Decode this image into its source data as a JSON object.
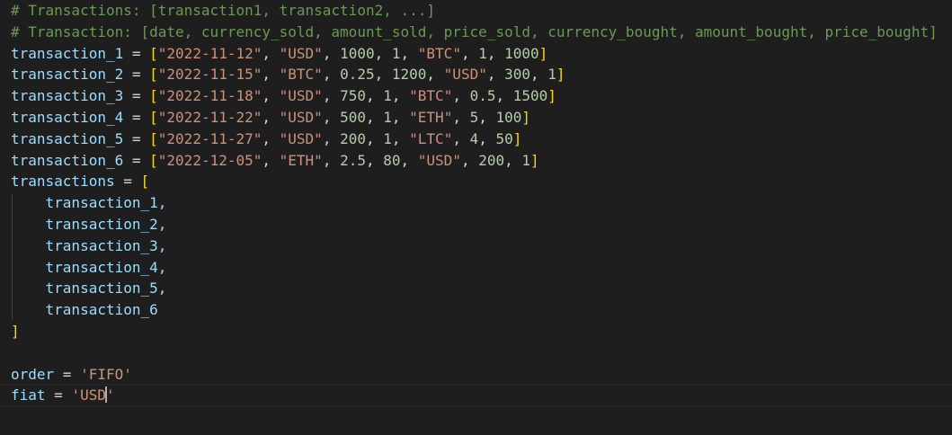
{
  "editor": {
    "comments": [
      "# Transactions: [transaction1, transaction2, ...]",
      "# Transaction: [date, currency_sold, amount_sold, price_sold, currency_bought, amount_bought, price_bought]"
    ],
    "transactions": [
      {
        "name": "transaction_1",
        "date": "\"2022-11-12\"",
        "currency_sold": "\"USD\"",
        "amount_sold": "1000",
        "price_sold": "1",
        "currency_bought": "\"BTC\"",
        "amount_bought": "1",
        "price_bought": "1000"
      },
      {
        "name": "transaction_2",
        "date": "\"2022-11-15\"",
        "currency_sold": "\"BTC\"",
        "amount_sold": "0.25",
        "price_sold": "1200",
        "currency_bought": "\"USD\"",
        "amount_bought": "300",
        "price_bought": "1"
      },
      {
        "name": "transaction_3",
        "date": "\"2022-11-18\"",
        "currency_sold": "\"USD\"",
        "amount_sold": "750",
        "price_sold": "1",
        "currency_bought": "\"BTC\"",
        "amount_bought": "0.5",
        "price_bought": "1500"
      },
      {
        "name": "transaction_4",
        "date": "\"2022-11-22\"",
        "currency_sold": "\"USD\"",
        "amount_sold": "500",
        "price_sold": "1",
        "currency_bought": "\"ETH\"",
        "amount_bought": "5",
        "price_bought": "100"
      },
      {
        "name": "transaction_5",
        "date": "\"2022-11-27\"",
        "currency_sold": "\"USD\"",
        "amount_sold": "200",
        "price_sold": "1",
        "currency_bought": "\"LTC\"",
        "amount_bought": "4",
        "price_bought": "50"
      },
      {
        "name": "transaction_6",
        "date": "\"2022-12-05\"",
        "currency_sold": "\"ETH\"",
        "amount_sold": "2.5",
        "price_sold": "80",
        "currency_bought": "\"USD\"",
        "amount_bought": "200",
        "price_bought": "1"
      }
    ],
    "list_name": "transactions",
    "list_items": [
      "transaction_1,",
      "transaction_2,",
      "transaction_3,",
      "transaction_4,",
      "transaction_5,",
      "transaction_6"
    ],
    "order": {
      "name": "order",
      "value": "'FIFO'"
    },
    "fiat": {
      "name": "fiat",
      "value_before_cursor": "'USD",
      "value_after_cursor": "'"
    },
    "syntax_colors": {
      "comment": "#6a9955",
      "variable": "#9cdcfe",
      "string": "#ce9178",
      "number": "#b5cea8",
      "bracket": "#ffd700",
      "background": "#1e1e1e"
    }
  }
}
